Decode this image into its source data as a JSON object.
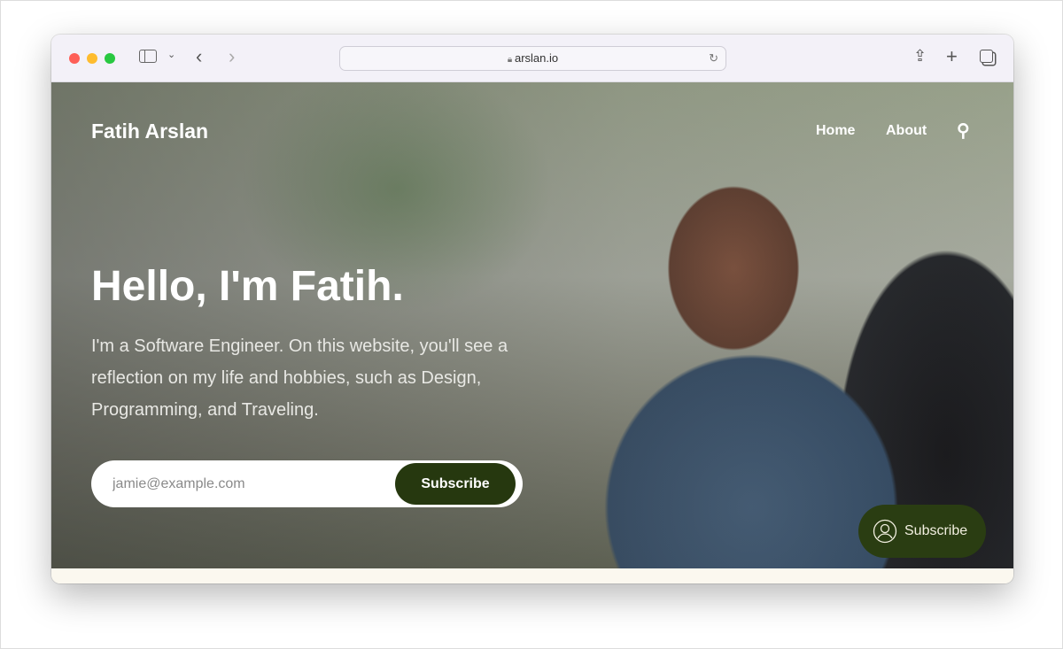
{
  "browser": {
    "url": "arslan.io",
    "icons": [
      "sidebar-icon",
      "chevron-down-icon",
      "back-icon",
      "forward-icon",
      "lock-icon",
      "reload-icon",
      "share-icon",
      "new-tab-icon",
      "tabs-icon"
    ]
  },
  "site": {
    "brand": "Fatih Arslan",
    "nav": [
      {
        "label": "Home"
      },
      {
        "label": "About"
      }
    ],
    "search_icon": "search-icon"
  },
  "hero": {
    "title": "Hello, I'm Fatih.",
    "subtitle": "I'm a Software Engineer. On this website, you'll see a reflection on my life and hobbies, such as Design, Programming, and Traveling.",
    "email_placeholder": "jamie@example.com",
    "subscribe_label": "Subscribe"
  },
  "floating": {
    "label": "Subscribe",
    "icon": "user-icon",
    "color": "#2a3d12"
  }
}
